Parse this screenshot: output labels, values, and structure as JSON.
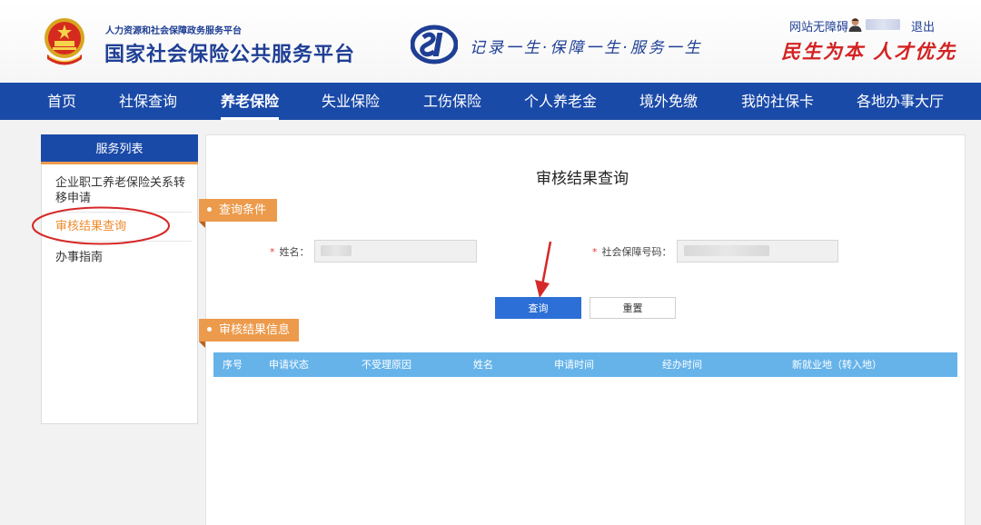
{
  "header": {
    "org_subtitle": "人力资源和社会保障政务服务平台",
    "org_title": "国家社会保险公共服务平台",
    "slogan": "记录一生·保障一生·服务一生",
    "accessibility_link": "网站无障碍",
    "logout_label": "退出",
    "motto": "民生为本 人才优先",
    "brand_color": "#1f3f95",
    "motto_color": "#d42222"
  },
  "nav": {
    "items": [
      {
        "label": "首页"
      },
      {
        "label": "社保查询"
      },
      {
        "label": "养老保险"
      },
      {
        "label": "失业保险"
      },
      {
        "label": "工伤保险"
      },
      {
        "label": "个人养老金"
      },
      {
        "label": "境外免缴"
      },
      {
        "label": "我的社保卡"
      },
      {
        "label": "各地办事大厅"
      }
    ],
    "active": "养老保险",
    "bar_color": "#1a4aa8"
  },
  "sidebar": {
    "title": "服务列表",
    "items": [
      {
        "label": "企业职工养老保险关系转移申请"
      },
      {
        "label": "审核结果查询"
      },
      {
        "label": "办事指南"
      }
    ],
    "active": "审核结果查询",
    "accent_color": "#ec9a4c"
  },
  "main": {
    "title": "审核结果查询",
    "query_section_label": "查询条件",
    "result_section_label": "审核结果信息",
    "form": {
      "name_label": "姓名：",
      "name_value": "",
      "ssn_label": "社会保障号码：",
      "ssn_value": "",
      "required_mark": "*"
    },
    "buttons": {
      "query": "查询",
      "reset": "重置"
    },
    "table": {
      "columns": [
        "序号",
        "申请状态",
        "不受理原因",
        "姓名",
        "申请时间",
        "经办时间",
        "新就业地（转入地）"
      ],
      "rows": [],
      "header_color": "#66b3ea"
    }
  }
}
